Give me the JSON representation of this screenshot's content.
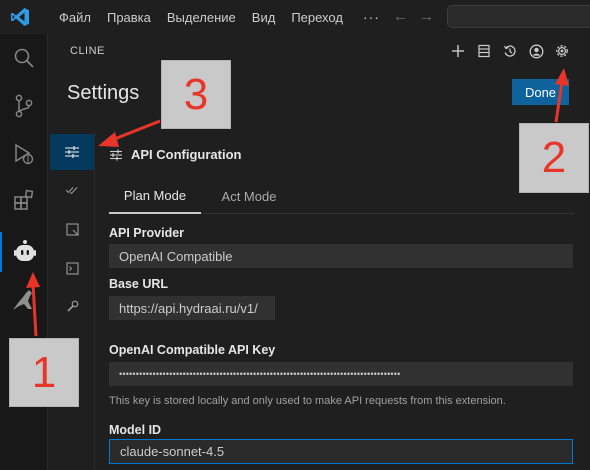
{
  "titlebar": {
    "menu": [
      "Файл",
      "Правка",
      "Выделение",
      "Вид",
      "Переход"
    ],
    "more": "···"
  },
  "panel": {
    "header": "CLINE",
    "title": "Settings",
    "done_label": "Done"
  },
  "section": {
    "title": "API Configuration",
    "tabs": [
      "Plan Mode",
      "Act Mode"
    ]
  },
  "fields": {
    "api_provider_label": "API Provider",
    "api_provider_value": "OpenAI Compatible",
    "base_url_label": "Base URL",
    "base_url_value": "https://api.hydraai.ru/v1/",
    "api_key_label": "OpenAI Compatible API Key",
    "api_key_value": "••••••••••••••••••••••••••••••••••••••••••••••••••••••••••••••••••••••••••••••••••••",
    "help_text": "This key is stored locally and only used to make API requests from this extension.",
    "model_id_label": "Model ID",
    "model_id_value": "claude-sonnet-4.5"
  },
  "annotations": [
    "1",
    "2",
    "3"
  ],
  "colors": {
    "accent": "#0078d4",
    "done_button": "#0e639c",
    "annotation_red": "#e8352a"
  },
  "icons": {
    "activity": [
      "explorer-icon",
      "source-control-icon",
      "run-debug-icon",
      "extensions-icon",
      "cline-robot-icon",
      "kangaroo-icon",
      "database-icon"
    ],
    "panel_top": [
      "plus-icon",
      "history-db-icon",
      "history-icon",
      "account-icon",
      "gear-icon"
    ],
    "settings_sidebar": [
      "sliders-icon",
      "double-check-icon",
      "checkpoint-icon",
      "terminal-icon",
      "wrench-icon",
      "info-icon"
    ]
  }
}
